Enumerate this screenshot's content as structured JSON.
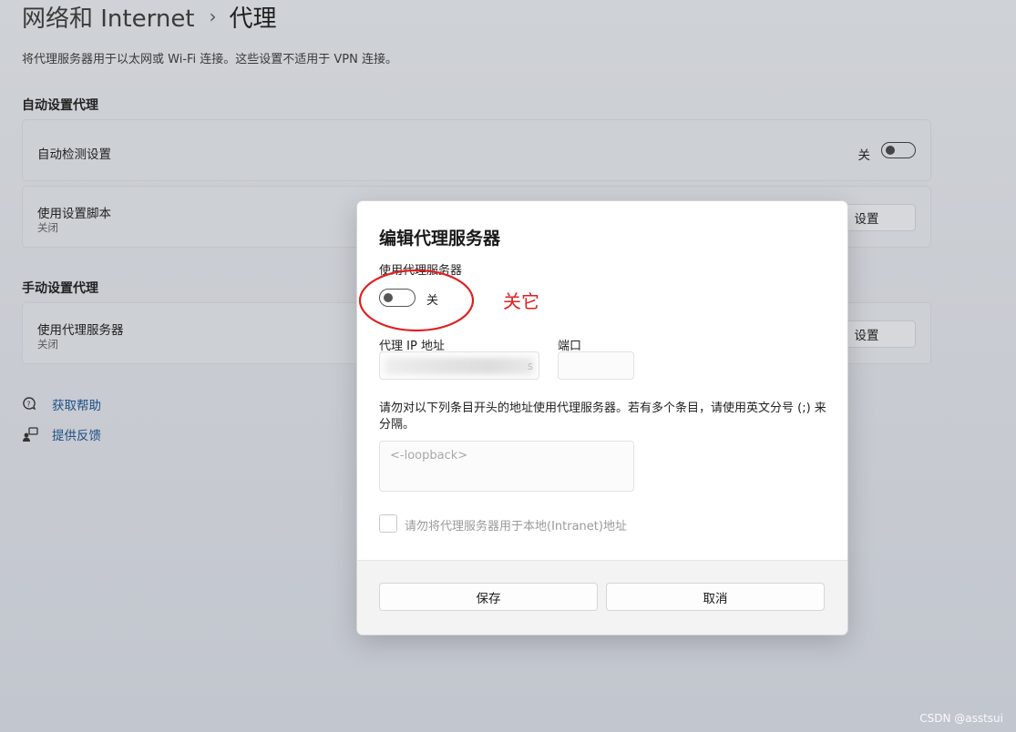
{
  "page": {
    "breadcrumb_parent": "网络和 Internet",
    "breadcrumb_separator": "›",
    "breadcrumb_current": "代理",
    "description": "将代理服务器用于以太网或 Wi-Fi 连接。这些设置不适用于 VPN 连接。"
  },
  "auto_section": {
    "title": "自动设置代理",
    "detect": {
      "title": "自动检测设置",
      "toggle_label": "关"
    },
    "script": {
      "title": "使用设置脚本",
      "subtitle": "关闭",
      "button": "设置"
    }
  },
  "manual_section": {
    "title": "手动设置代理",
    "proxy": {
      "title": "使用代理服务器",
      "subtitle": "关闭",
      "button": "设置"
    }
  },
  "links": {
    "help": "获取帮助",
    "feedback": "提供反馈"
  },
  "dialog": {
    "title": "编辑代理服务器",
    "use_proxy_label": "使用代理服务器",
    "toggle_label": "关",
    "ip_label": "代理 IP 地址",
    "ip_tail": "s",
    "port_label": "端口",
    "port_value": "",
    "exceptions_text": "请勿对以下列条目开头的地址使用代理服务器。若有多个条目，请使用英文分号 (;) 来分隔。",
    "exceptions_placeholder": "<-loopback>",
    "local_checkbox_label": "请勿将代理服务器用于本地(Intranet)地址",
    "save_button": "保存",
    "cancel_button": "取消"
  },
  "annotation": {
    "text": "关它",
    "color": "#e02020"
  },
  "watermark": "CSDN @asstsui"
}
